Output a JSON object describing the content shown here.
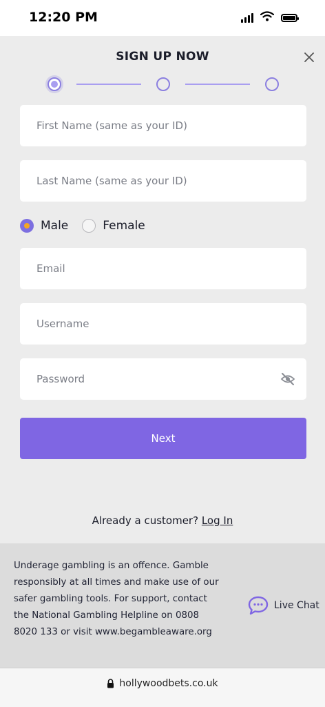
{
  "status_bar": {
    "time": "12:20 PM"
  },
  "header": {
    "title": "SIGN UP NOW"
  },
  "stepper": {
    "steps": 3,
    "active_step": 1
  },
  "form": {
    "first_name": {
      "placeholder": "First Name (same as your ID)",
      "value": ""
    },
    "last_name": {
      "placeholder": "Last Name (same as your ID)",
      "value": ""
    },
    "gender": {
      "options": [
        {
          "label": "Male",
          "selected": true
        },
        {
          "label": "Female",
          "selected": false
        }
      ]
    },
    "email": {
      "placeholder": "Email",
      "value": ""
    },
    "username": {
      "placeholder": "Username",
      "value": ""
    },
    "password": {
      "placeholder": "Password",
      "value": ""
    },
    "next_label": "Next"
  },
  "login": {
    "prompt": "Already a customer?",
    "link_label": "Log In"
  },
  "footer": {
    "disclaimer": "Underage gambling is an offence. Gamble responsibly at all times and make use of our safer gambling tools. For support, contact the National Gambling Helpline on 0808 8020 133 or visit www.begambleaware.org",
    "live_chat_label": "Live Chat"
  },
  "browser": {
    "url": "hollywoodbets.co.uk"
  },
  "colors": {
    "accent": "#7f66e3",
    "radio_dot": "#f4a623",
    "background": "#ececec",
    "footer_background": "#dcdcdc"
  },
  "icons": [
    "signal-icon",
    "wifi-icon",
    "battery-icon",
    "close-icon",
    "eye-off-icon",
    "chat-bubble-icon",
    "lock-icon"
  ]
}
